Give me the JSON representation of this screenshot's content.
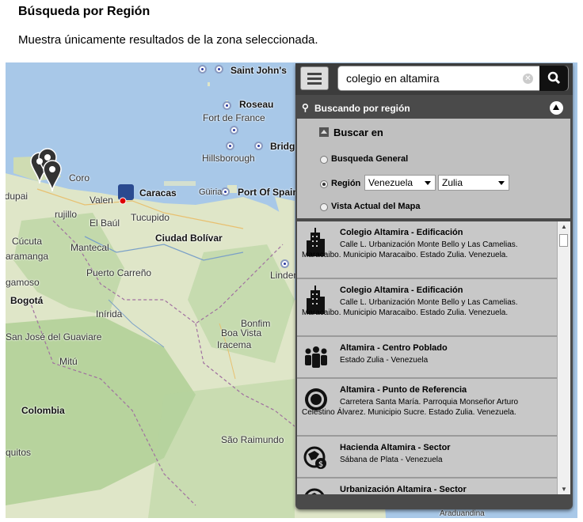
{
  "page": {
    "title": "Búsqueda por Región",
    "subtitle": "Muestra únicamente resultados de la zona seleccionada."
  },
  "map": {
    "labels": [
      {
        "id": "saint-johns",
        "text": "Saint John's",
        "bold": true
      },
      {
        "id": "roseau",
        "text": "Roseau",
        "bold": true
      },
      {
        "id": "fort-de-france",
        "text": "Fort de France",
        "bold": false
      },
      {
        "id": "bridg",
        "text": "Bridg",
        "bold": true
      },
      {
        "id": "hillsborough",
        "text": "Hillsborough",
        "bold": false
      },
      {
        "id": "coro",
        "text": "Coro",
        "bold": false
      },
      {
        "id": "caracas",
        "text": "Caracas",
        "bold": true
      },
      {
        "id": "guiria",
        "text": "Güiria",
        "bold": false
      },
      {
        "id": "port-of-spain",
        "text": "Port Of Spain",
        "bold": true
      },
      {
        "id": "valencia",
        "text": "Valen",
        "bold": false
      },
      {
        "id": "trujillo",
        "text": "rujillo",
        "bold": false
      },
      {
        "id": "tucupido",
        "text": "Tucupido",
        "bold": false
      },
      {
        "id": "el-baul",
        "text": "El Baúl",
        "bold": false
      },
      {
        "id": "ciudad-bolivar",
        "text": "Ciudad Bolívar",
        "bold": true
      },
      {
        "id": "cucuta",
        "text": "Cúcuta",
        "bold": false
      },
      {
        "id": "mantecal",
        "text": "Mantecal",
        "bold": false
      },
      {
        "id": "aramanga",
        "text": "aramanga",
        "bold": false
      },
      {
        "id": "puerto-carreno",
        "text": "Puerto Carreño",
        "bold": false
      },
      {
        "id": "gamoso",
        "text": "gamoso",
        "bold": false
      },
      {
        "id": "bogota",
        "text": "Bogotá",
        "bold": true
      },
      {
        "id": "inirida",
        "text": "Inírida",
        "bold": false
      },
      {
        "id": "bonfim",
        "text": "Bonfim",
        "bold": false
      },
      {
        "id": "boa-vista",
        "text": "Boa Vista",
        "bold": false
      },
      {
        "id": "iracema",
        "text": "Iracema",
        "bold": false
      },
      {
        "id": "san-jose",
        "text": "San José del Guaviare",
        "bold": false
      },
      {
        "id": "mitu",
        "text": "Mitú",
        "bold": false
      },
      {
        "id": "colombia",
        "text": "Colombia",
        "bold": true
      },
      {
        "id": "sao-raimundo",
        "text": "São Raimundo",
        "bold": false
      },
      {
        "id": "quitos",
        "text": "quitos",
        "bold": false
      },
      {
        "id": "linder",
        "text": "Linder",
        "bold": false
      },
      {
        "id": "eduda",
        "text": "edupai",
        "bold": false
      },
      {
        "id": "aradina",
        "text": "Araduandina",
        "bold": false
      }
    ]
  },
  "panel": {
    "search_value": "colegio en altamira",
    "region_header": "Buscando por región",
    "filter_title": "Buscar en",
    "options": {
      "general": "Busqueda General",
      "region": "Región",
      "current_view": "Vista Actual del Mapa"
    },
    "country_select": "Venezuela",
    "state_select": "Zulia",
    "results": [
      {
        "title": "Colegio Altamira - Edificación",
        "desc": "Calle L. Urbanización Monte Bello y Las Camelias. Maracaibo. Municipio Maracaibo. Estado Zulia. Venezuela.",
        "icon": "building-icon"
      },
      {
        "title": "Colegio Altamira - Edificación",
        "desc": "Calle L. Urbanización Monte Bello y Las Camelias. Maracaibo. Municipio Maracaibo. Estado Zulia. Venezuela.",
        "icon": "building-icon"
      },
      {
        "title": "Altamira - Centro Poblado",
        "desc": "Estado Zulia - Venezuela",
        "icon": "people-icon"
      },
      {
        "title": "Altamira - Punto de Referencia",
        "desc": "Carretera Santa María. Parroquia Monseñor Arturo Celestino Álvarez. Municipio Sucre. Estado Zulia. Venezuela.",
        "icon": "target-icon"
      },
      {
        "title": "Hacienda Altamira - Sector",
        "desc": "Sábana de Plata - Venezuela",
        "icon": "globe-money-icon"
      },
      {
        "title": "Urbanización Altamira - Sector",
        "desc": "",
        "icon": "globe-money-icon"
      }
    ]
  }
}
